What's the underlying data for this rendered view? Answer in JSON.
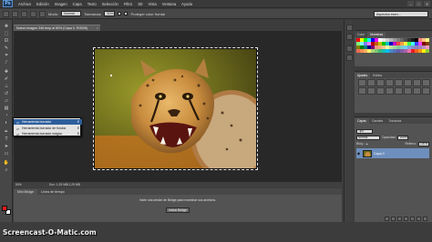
{
  "app": {
    "logo": "Ps",
    "menus": [
      "Archivo",
      "Edición",
      "Imagen",
      "Capa",
      "Texto",
      "Selección",
      "Filtro",
      "3D",
      "Vista",
      "Ventana",
      "Ayuda"
    ],
    "window_controls": [
      "–",
      "□",
      "✕"
    ]
  },
  "options": {
    "mode_label": "Modo:",
    "mode_value": "Normal",
    "tolerance_label": "Tolerancia:",
    "tolerance_value": "50%",
    "protect_label": "Proteger color frontal",
    "workspace_value": "Aspectos esen..."
  },
  "document": {
    "tab_title": "Nuevo imagen 346.bmp al 50% (Capa 0, RGB/8)",
    "close": "×"
  },
  "flyout": {
    "items": [
      {
        "icon": "eraser-icon",
        "glyph": "▱",
        "label": "Herramienta borrador",
        "key": "E"
      },
      {
        "icon": "background-eraser-icon",
        "glyph": "▱",
        "label": "Herramienta borrador de fondos",
        "key": "E"
      },
      {
        "icon": "magic-eraser-icon",
        "glyph": "▱",
        "label": "Herramienta borrador mágico",
        "key": "E"
      }
    ]
  },
  "status": {
    "zoom": "50%",
    "doc_info": "Doc: 1,25 MB/1,25 MB"
  },
  "bridge": {
    "tabs": [
      "Mini Bridge",
      "Línea de tiempo"
    ],
    "message": "Inicie una sesión de Bridge para examinar sus archivos.",
    "button": "Iniciar Bridge"
  },
  "panels": {
    "color_tabs": [
      "Color",
      "Muestras"
    ],
    "adjust_tabs": [
      "Ajustes",
      "Estilos"
    ],
    "layers_tabs": [
      "Capas",
      "Canales",
      "Trazados"
    ],
    "kind_value": "Tipo",
    "blend_value": "Normal",
    "opacity_label": "Opacidad:",
    "opacity_value": "100%",
    "lock_label": "Bloq.:",
    "fill_label": "Relleno:",
    "fill_value": "100%",
    "layer_name": "Capa 0"
  },
  "watermark": "Screencast-O-Matic.com",
  "colors": {
    "foreground": "#e31c1c",
    "background": "#ffffff",
    "selection_highlight": "#2e5f9c",
    "layer_selected": "#6e8fbd"
  },
  "swatches": [
    "#ff0000",
    "#ffff00",
    "#00ff00",
    "#00ffff",
    "#0000ff",
    "#ff00ff",
    "#ffffff",
    "#e6e6e6",
    "#cccccc",
    "#b3b3b3",
    "#999999",
    "#808080",
    "#666666",
    "#4d4d4d",
    "#333333",
    "#1a1a1a",
    "#000000",
    "#ff8080",
    "#ffbf80",
    "#ffff80",
    "#80ff80",
    "#80ffff",
    "#8080ff",
    "#ff80ff",
    "#c00000",
    "#c06000",
    "#c0c000",
    "#00c000",
    "#00c0c0",
    "#0000c0",
    "#c000c0",
    "#ff4040",
    "#ff9f40",
    "#ffef40",
    "#40ff40",
    "#40ffef",
    "#4040ff",
    "#ef40ff",
    "#800000",
    "#804000",
    "#808000",
    "#008000",
    "#008080",
    "#000080",
    "#800080",
    "#f7977a",
    "#f9ad81",
    "#fdc68a",
    "#fff79a",
    "#c4df9b",
    "#a3d39c",
    "#82ca9d",
    "#7bcdc8",
    "#6ecff6",
    "#7ea7d8",
    "#8493ca",
    "#8882be",
    "#a187be",
    "#bc8dbf",
    "#f49ac2",
    "#f26c4f",
    "#f68e55",
    "#fbaf5c",
    "#fff467",
    "#acd372",
    "#7cc576",
    "#3bb878",
    "#1abbb4",
    "#00bff3",
    "#438cca",
    "#5574b9",
    "#605ca8",
    "#855fa8",
    "#a763a8",
    "#f06ea9",
    "#ed1c24",
    "#f26522",
    "#f7941d",
    "#fff200",
    "#8dc73f"
  ],
  "adjust_icons": [
    "brightness-icon",
    "levels-icon",
    "curves-icon",
    "exposure-icon",
    "vibrance-icon",
    "hue-icon",
    "balance-icon",
    "bw-icon",
    "photo-filter-icon",
    "mixer-icon",
    "lookup-icon",
    "invert-icon",
    "posterize-icon",
    "threshold-icon",
    "gradient-map-icon",
    "selective-color-icon"
  ]
}
